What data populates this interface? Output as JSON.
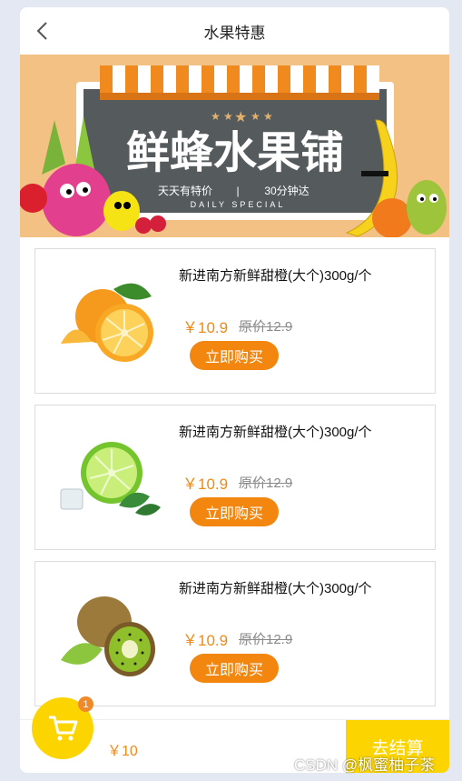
{
  "header": {
    "title": "水果特惠",
    "back_icon": "chevron-left-icon"
  },
  "banner": {
    "title": "鲜蜂水果铺",
    "slogan_left": "天天有特价",
    "divider": "|",
    "slogan_right": "30分钟达",
    "subtitle": "DAILY SPECIAL"
  },
  "products": [
    {
      "name": "新进南方新鲜甜橙(大个)300g/个",
      "price": "￥10.9",
      "original_price": "原价12.9",
      "buy_label": "立即购买",
      "image": "orange"
    },
    {
      "name": "新进南方新鲜甜橙(大个)300g/个",
      "price": "￥10.9",
      "original_price": "原价12.9",
      "buy_label": "立即购买",
      "image": "lime"
    },
    {
      "name": "新进南方新鲜甜橙(大个)300g/个",
      "price": "￥10.9",
      "original_price": "原价12.9",
      "buy_label": "立即购买",
      "image": "kiwi"
    }
  ],
  "cart": {
    "badge_count": "1",
    "total": "￥10",
    "checkout_label": "去结算",
    "cart_icon": "cart-icon"
  },
  "watermark": "CSDN @枫蜜柚子茶",
  "colors": {
    "accent_orange": "#f2860f",
    "cart_yellow": "#fcd400",
    "banner_bg": "#f4c184"
  }
}
